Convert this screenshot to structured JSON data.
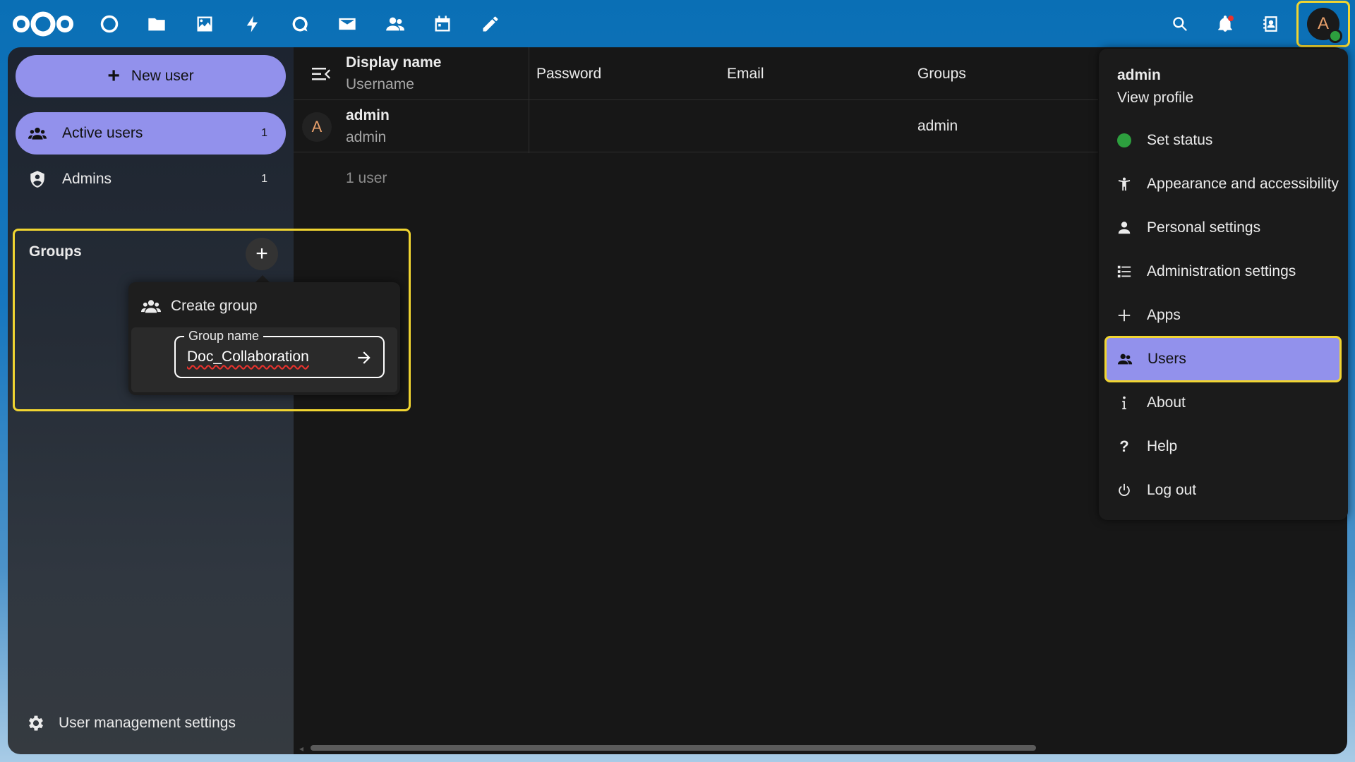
{
  "topbar": {
    "apps": [
      {
        "name": "dashboard-app-icon"
      },
      {
        "name": "files-app-icon"
      },
      {
        "name": "photos-app-icon"
      },
      {
        "name": "activity-app-icon"
      },
      {
        "name": "talk-app-icon"
      },
      {
        "name": "mail-app-icon"
      },
      {
        "name": "contacts-app-icon"
      },
      {
        "name": "calendar-app-icon"
      },
      {
        "name": "notes-app-icon"
      }
    ],
    "avatar_initial": "A",
    "status_color": "#2d9f3e",
    "highlight_color": "#f1d531"
  },
  "sidebar": {
    "new_user_label": "New user",
    "nav": [
      {
        "label": "Active users",
        "count": "1"
      },
      {
        "label": "Admins",
        "count": "1"
      }
    ],
    "groups_title": "Groups",
    "create_group": {
      "title": "Create group",
      "field_label": "Group name",
      "field_value": "Doc_Collaboration"
    },
    "settings_label": "User management settings",
    "accent_color": "#9291ec"
  },
  "table": {
    "headers": {
      "display_name": "Display name",
      "username": "Username",
      "password": "Password",
      "email": "Email",
      "groups": "Groups"
    },
    "rows": [
      {
        "avatar": "A",
        "display_name": "admin",
        "username": "admin",
        "groups": "admin"
      }
    ],
    "count_label": "1 user"
  },
  "user_menu": {
    "name": "admin",
    "view_profile": "View profile",
    "items": [
      {
        "label": "Set status"
      },
      {
        "label": "Appearance and accessibility"
      },
      {
        "label": "Personal settings"
      },
      {
        "label": "Administration settings"
      },
      {
        "label": "Apps"
      },
      {
        "label": "Users"
      },
      {
        "label": "About"
      },
      {
        "label": "Help"
      },
      {
        "label": "Log out"
      }
    ]
  }
}
